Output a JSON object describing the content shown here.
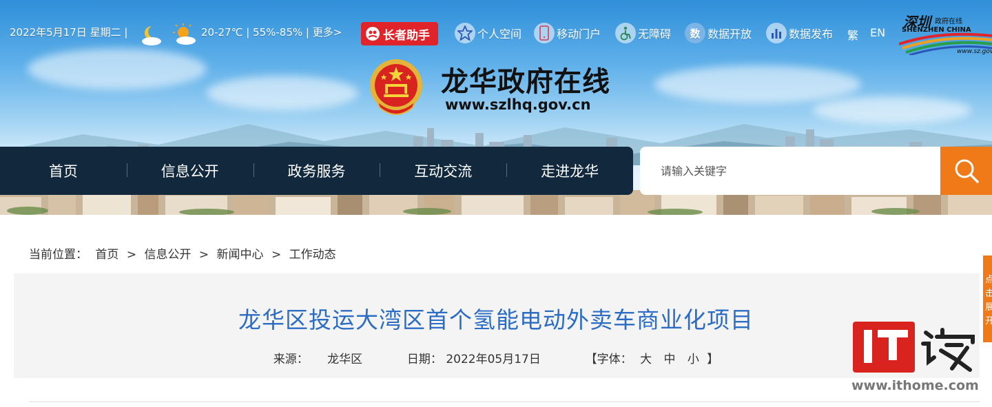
{
  "topbar": {
    "date_text": "2022年5月17日 星期二 |",
    "weather_text": "20-27℃ | 55%-85% | 更多>",
    "elder_assistant": "长者助手",
    "links": [
      {
        "label": "个人空间",
        "icon": "personal-space-icon"
      },
      {
        "label": "移动门户",
        "icon": "mobile-portal-icon"
      },
      {
        "label": "无障碍",
        "icon": "accessibility-icon"
      },
      {
        "label": "数据开放",
        "icon": "open-data-icon"
      },
      {
        "label": "数据发布",
        "icon": "data-release-icon"
      }
    ],
    "lang_traditional": "繁",
    "lang_english": "EN"
  },
  "sz_logo": {
    "calligraphy": "深圳",
    "subtitle": "政府在线",
    "english": "SHENZHEN CHINA",
    "url": "www.sz.gov"
  },
  "site": {
    "title": "龙华政府在线",
    "url": "www.szlhq.gov.cn"
  },
  "nav": {
    "items": [
      "首页",
      "信息公开",
      "政务服务",
      "互动交流",
      "走进龙华"
    ]
  },
  "search": {
    "placeholder": "请输入关键字"
  },
  "breadcrumb": {
    "prefix": "当前位置：",
    "items": [
      "首页",
      "信息公开",
      "新闻中心",
      "工作动态"
    ],
    "separator": ">"
  },
  "article": {
    "title": "龙华区投运大湾区首个氢能电动外卖车商业化项目",
    "source_label": "来源：",
    "source_value": "龙华区",
    "date_label": "日期：",
    "date_value": "2022年05月17日",
    "font_label": "【字体：",
    "font_sizes": [
      "大",
      "中",
      "小"
    ],
    "font_close": "】"
  },
  "side_tab": {
    "text": "点击展开"
  },
  "watermark": {
    "logo_text": "IT之家",
    "url": "www.ithome.com"
  },
  "colors": {
    "nav_bg": "#12293d",
    "accent_orange": "#f07a17",
    "title_blue": "#2b6cc4",
    "elder_red": "#e0242a"
  }
}
